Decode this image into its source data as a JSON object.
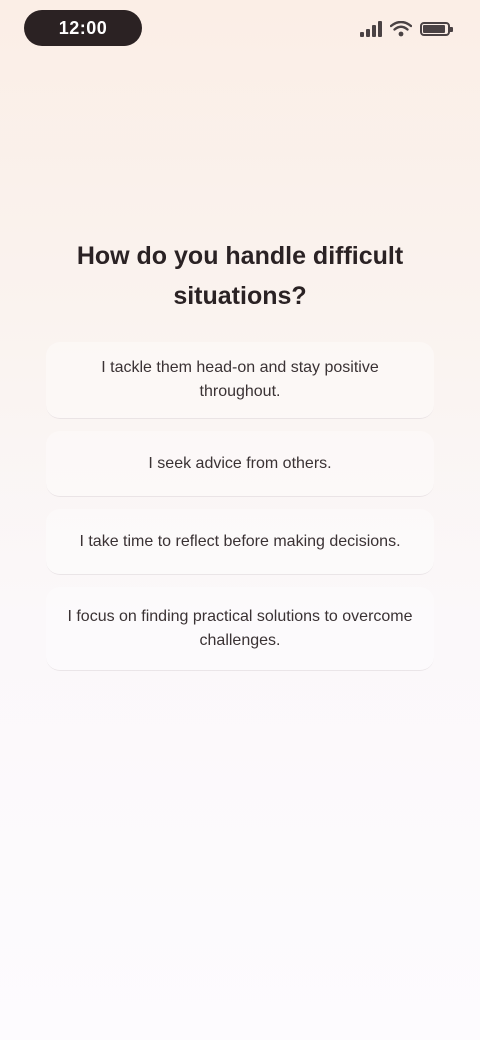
{
  "status_bar": {
    "time": "12:00",
    "battery_level": 0.9,
    "signal_bars": 4
  },
  "quiz": {
    "question": "How do you handle difficult situations?",
    "options": [
      {
        "label": "I tackle them head-on and stay positive throughout."
      },
      {
        "label": "I seek advice from others."
      },
      {
        "label": "I take time to reflect before making decisions."
      },
      {
        "label": "I focus on finding practical solutions to overcome challenges."
      }
    ]
  },
  "colors": {
    "background_top": "#fbeee6",
    "background_bottom": "#fdfbfe",
    "text": "#2a2224",
    "pill": "#2b2223"
  }
}
